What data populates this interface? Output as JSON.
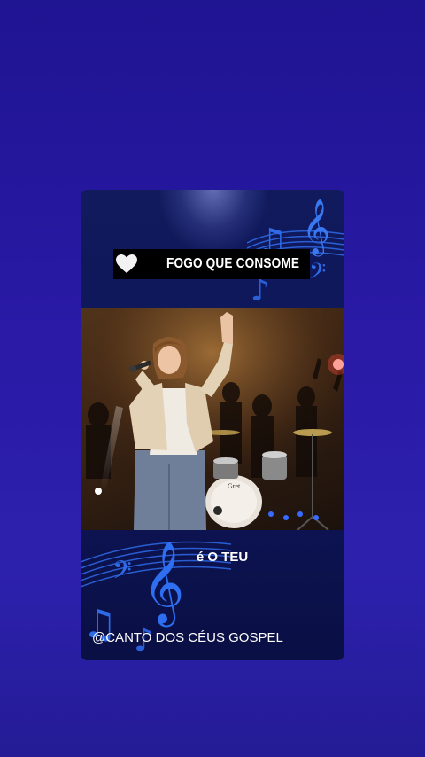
{
  "card": {
    "title": "FOGO QUE CONSOME",
    "lyric_prefix": "é",
    "lyric_highlight": "O TEU",
    "channel": "@CANTO DOS CÉUS GOSPEL",
    "heart_icon": "heart-icon",
    "video_label": "worship-singer-video"
  },
  "colors": {
    "background": "#2a1aa6",
    "card_background": "#0d1556",
    "notes": "#2f6be8",
    "title_bar": "#000000",
    "text": "#ffffff"
  }
}
